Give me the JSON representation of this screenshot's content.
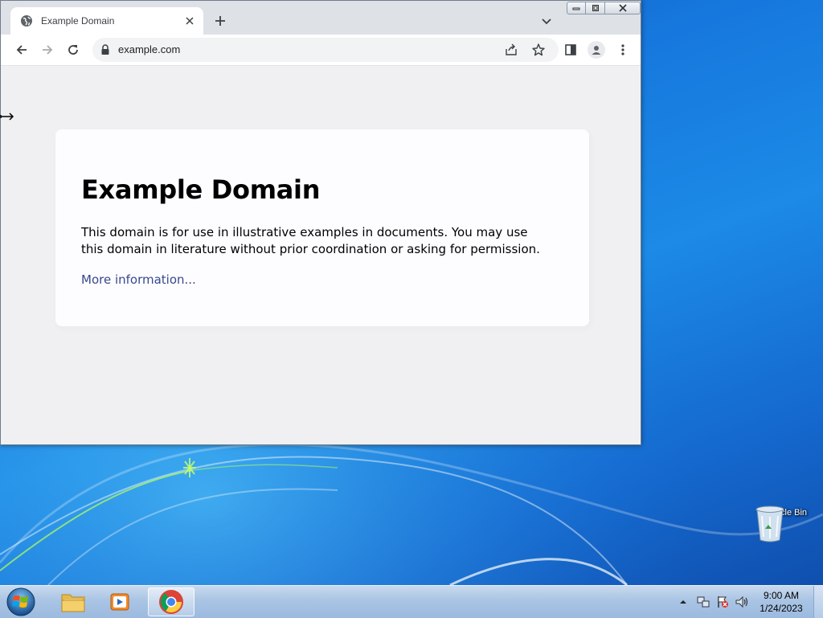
{
  "browser": {
    "tab": {
      "title": "Example Domain"
    },
    "address_bar": {
      "url": "example.com"
    }
  },
  "page": {
    "heading": "Example Domain",
    "paragraph": "This domain is for use in illustrative examples in documents. You may use this domain in literature without prior coordination or asking for permission.",
    "link_text": "More information..."
  },
  "desktop": {
    "icons": [
      {
        "label": "Recycle Bin",
        "icon": "recycle-bin-icon"
      }
    ]
  },
  "taskbar": {
    "pinned": [
      {
        "name": "windows-explorer",
        "icon": "folder-icon"
      },
      {
        "name": "media-player",
        "icon": "media-player-icon"
      },
      {
        "name": "chrome",
        "icon": "chrome-icon",
        "active": true
      }
    ],
    "clock": {
      "time": "9:00 AM",
      "date": "1/24/2023"
    }
  },
  "colors": {
    "link": "#38488f",
    "page_bg": "#f0f0f2",
    "card_bg": "#fdfdff",
    "desktop_blue": "#1677dd"
  }
}
